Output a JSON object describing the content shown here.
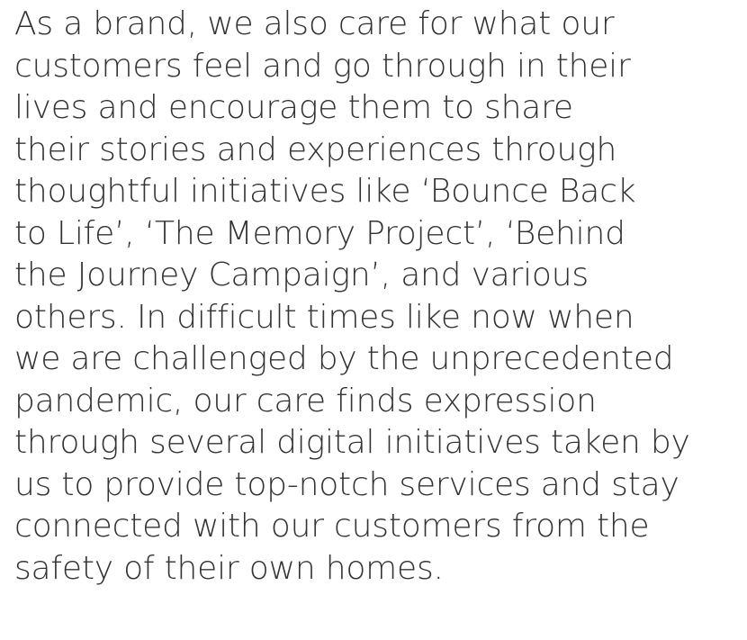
{
  "paragraph": {
    "lines": [
      "As a brand, we also care for what our",
      "customers feel and go through in their",
      "lives and encourage them to share",
      "their stories and experiences through",
      "thoughtful initiatives like ‘Bounce Back",
      "to Life’, ‘The Memory Project’, ‘Behind",
      "the Journey Campaign’, and various",
      "others. In difficult times like now when",
      "we are challenged by the unprecedented",
      "pandemic, our care finds expression",
      "through several digital initiatives taken by",
      "us to provide top-notch services and stay",
      "connected with our customers from the",
      "safety of their own homes."
    ]
  },
  "colors": {
    "text": "#333333",
    "background": "#ffffff"
  }
}
